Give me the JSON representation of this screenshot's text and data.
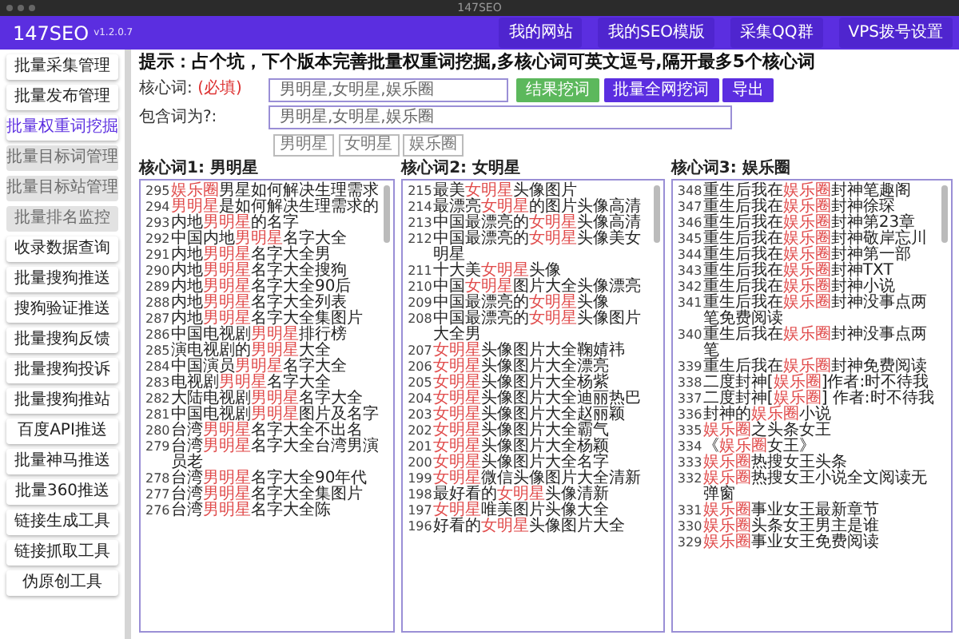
{
  "window": {
    "title": "147SEO"
  },
  "navbar": {
    "brand": "147SEO",
    "version": "v1.2.0.7",
    "links": [
      "我的网站",
      "我的SEO模版",
      "采集QQ群",
      "VPS拨号设置"
    ]
  },
  "sidebar": {
    "items": [
      {
        "label": "批量采集管理",
        "selected": false,
        "disabled": false
      },
      {
        "label": "批量发布管理",
        "selected": false,
        "disabled": false
      },
      {
        "label": "批量权重词挖掘",
        "selected": true,
        "disabled": false
      },
      {
        "label": "批量目标词管理",
        "selected": false,
        "disabled": true
      },
      {
        "label": "批量目标站管理",
        "selected": false,
        "disabled": true
      },
      {
        "label": "批量排名监控",
        "selected": false,
        "disabled": true
      },
      {
        "label": "收录数据查询",
        "selected": false,
        "disabled": false
      },
      {
        "label": "批量搜狗推送",
        "selected": false,
        "disabled": false
      },
      {
        "label": "搜狗验证推送",
        "selected": false,
        "disabled": false
      },
      {
        "label": "批量搜狗反馈",
        "selected": false,
        "disabled": false
      },
      {
        "label": "批量搜狗投诉",
        "selected": false,
        "disabled": false
      },
      {
        "label": "批量搜狗推站",
        "selected": false,
        "disabled": false
      },
      {
        "label": "百度API推送",
        "selected": false,
        "disabled": false
      },
      {
        "label": "批量神马推送",
        "selected": false,
        "disabled": false
      },
      {
        "label": "批量360推送",
        "selected": false,
        "disabled": false
      },
      {
        "label": "链接生成工具",
        "selected": false,
        "disabled": false
      },
      {
        "label": "链接抓取工具",
        "selected": false,
        "disabled": false
      },
      {
        "label": "伪原创工具",
        "selected": false,
        "disabled": false
      }
    ]
  },
  "tip": "提示：占个坑，下个版本完善批量权重词挖掘,多核心词可英文逗号,隔开最多5个核心词",
  "core_field": {
    "label": "核心词:",
    "required_note": "(必填)",
    "value": "男明星,女明星,娱乐圈"
  },
  "buttons": [
    {
      "label": "结果挖词",
      "kind": "success"
    },
    {
      "label": "批量全网挖词",
      "kind": "primary"
    },
    {
      "label": "导出",
      "kind": "primary"
    }
  ],
  "include_field": {
    "label": "包含词为?:",
    "value": "男明星,女明星,娱乐圈",
    "tags": [
      "男明星",
      "女明星",
      "娱乐圈"
    ]
  },
  "columns": [
    {
      "title": "核心词1: 男明星",
      "rows": [
        {
          "number": "295",
          "parts": [
            {
              "text": "娱乐圈",
              "highlight": true
            },
            {
              "text": "男星如何解决生理需求",
              "highlight": false
            }
          ]
        },
        {
          "number": "294",
          "parts": [
            {
              "text": "男明星",
              "highlight": true
            },
            {
              "text": "是如何解决生理需求的",
              "highlight": false
            }
          ]
        },
        {
          "number": "293",
          "parts": [
            {
              "text": "内地",
              "highlight": false
            },
            {
              "text": "男明星",
              "highlight": true
            },
            {
              "text": "的名字",
              "highlight": false
            }
          ]
        },
        {
          "number": "292",
          "parts": [
            {
              "text": "中国内地",
              "highlight": false
            },
            {
              "text": "男明星",
              "highlight": true
            },
            {
              "text": "名字大全",
              "highlight": false
            }
          ]
        },
        {
          "number": "291",
          "parts": [
            {
              "text": "内地",
              "highlight": false
            },
            {
              "text": "男明星",
              "highlight": true
            },
            {
              "text": "名字大全男",
              "highlight": false
            }
          ]
        },
        {
          "number": "290",
          "parts": [
            {
              "text": "内地",
              "highlight": false
            },
            {
              "text": "男明星",
              "highlight": true
            },
            {
              "text": "名字大全搜狗",
              "highlight": false
            }
          ]
        },
        {
          "number": "289",
          "parts": [
            {
              "text": "内地",
              "highlight": false
            },
            {
              "text": "男明星",
              "highlight": true
            },
            {
              "text": "名字大全90后",
              "highlight": false
            }
          ]
        },
        {
          "number": "288",
          "parts": [
            {
              "text": "内地",
              "highlight": false
            },
            {
              "text": "男明星",
              "highlight": true
            },
            {
              "text": "名字大全列表",
              "highlight": false
            }
          ]
        },
        {
          "number": "287",
          "parts": [
            {
              "text": "内地",
              "highlight": false
            },
            {
              "text": "男明星",
              "highlight": true
            },
            {
              "text": "名字大全集图片",
              "highlight": false
            }
          ]
        },
        {
          "number": "286",
          "parts": [
            {
              "text": "中国电视剧",
              "highlight": false
            },
            {
              "text": "男明星",
              "highlight": true
            },
            {
              "text": "排行榜",
              "highlight": false
            }
          ]
        },
        {
          "number": "285",
          "parts": [
            {
              "text": "演电视剧的",
              "highlight": false
            },
            {
              "text": "男明星",
              "highlight": true
            },
            {
              "text": "大全",
              "highlight": false
            }
          ]
        },
        {
          "number": "284",
          "parts": [
            {
              "text": "中国演员",
              "highlight": false
            },
            {
              "text": "男明星",
              "highlight": true
            },
            {
              "text": "名字大全",
              "highlight": false
            }
          ]
        },
        {
          "number": "283",
          "parts": [
            {
              "text": "电视剧",
              "highlight": false
            },
            {
              "text": "男明星",
              "highlight": true
            },
            {
              "text": "名字大全",
              "highlight": false
            }
          ]
        },
        {
          "number": "282",
          "parts": [
            {
              "text": "大陆电视剧",
              "highlight": false
            },
            {
              "text": "男明星",
              "highlight": true
            },
            {
              "text": "名字大全",
              "highlight": false
            }
          ]
        },
        {
          "number": "281",
          "parts": [
            {
              "text": "中国电视剧",
              "highlight": false
            },
            {
              "text": "男明星",
              "highlight": true
            },
            {
              "text": "图片及名字",
              "highlight": false
            }
          ]
        },
        {
          "number": "280",
          "parts": [
            {
              "text": "台湾",
              "highlight": false
            },
            {
              "text": "男明星",
              "highlight": true
            },
            {
              "text": "名字大全不出名",
              "highlight": false
            }
          ]
        },
        {
          "number": "279",
          "parts": [
            {
              "text": "台湾",
              "highlight": false
            },
            {
              "text": "男明星",
              "highlight": true
            },
            {
              "text": "名字大全台湾男演员老",
              "highlight": false
            }
          ]
        },
        {
          "number": "278",
          "parts": [
            {
              "text": "台湾",
              "highlight": false
            },
            {
              "text": "男明星",
              "highlight": true
            },
            {
              "text": "名字大全90年代",
              "highlight": false
            }
          ]
        },
        {
          "number": "277",
          "parts": [
            {
              "text": "台湾",
              "highlight": false
            },
            {
              "text": "男明星",
              "highlight": true
            },
            {
              "text": "名字大全集图片",
              "highlight": false
            }
          ]
        },
        {
          "number": "276",
          "parts": [
            {
              "text": "台湾",
              "highlight": false
            },
            {
              "text": "男明星",
              "highlight": true
            },
            {
              "text": "名字大全陈",
              "highlight": false
            }
          ]
        }
      ]
    },
    {
      "title": "核心词2: 女明星",
      "rows": [
        {
          "number": "215",
          "parts": [
            {
              "text": "最美",
              "highlight": false
            },
            {
              "text": "女明星",
              "highlight": true
            },
            {
              "text": "头像图片",
              "highlight": false
            }
          ]
        },
        {
          "number": "214",
          "parts": [
            {
              "text": "最漂亮",
              "highlight": false
            },
            {
              "text": "女明星",
              "highlight": true
            },
            {
              "text": "的图片头像高清",
              "highlight": false
            }
          ]
        },
        {
          "number": "213",
          "parts": [
            {
              "text": "中国最漂亮的",
              "highlight": false
            },
            {
              "text": "女明星",
              "highlight": true
            },
            {
              "text": "头像高清",
              "highlight": false
            }
          ]
        },
        {
          "number": "212",
          "parts": [
            {
              "text": "中国最漂亮的",
              "highlight": false
            },
            {
              "text": "女明星",
              "highlight": true
            },
            {
              "text": "头像美女明星",
              "highlight": false
            }
          ]
        },
        {
          "number": "211",
          "parts": [
            {
              "text": "十大美",
              "highlight": false
            },
            {
              "text": "女明星",
              "highlight": true
            },
            {
              "text": "头像",
              "highlight": false
            }
          ]
        },
        {
          "number": "210",
          "parts": [
            {
              "text": "中国",
              "highlight": false
            },
            {
              "text": "女明星",
              "highlight": true
            },
            {
              "text": "图片大全头像漂亮",
              "highlight": false
            }
          ]
        },
        {
          "number": "209",
          "parts": [
            {
              "text": "中国最漂亮的",
              "highlight": false
            },
            {
              "text": "女明星",
              "highlight": true
            },
            {
              "text": "头像",
              "highlight": false
            }
          ]
        },
        {
          "number": "208",
          "parts": [
            {
              "text": "中国最漂亮的",
              "highlight": false
            },
            {
              "text": "女明星",
              "highlight": true
            },
            {
              "text": "头像图片大全男",
              "highlight": false
            }
          ]
        },
        {
          "number": "207",
          "parts": [
            {
              "text": "女明星",
              "highlight": true
            },
            {
              "text": "头像图片大全鞠婧祎",
              "highlight": false
            }
          ]
        },
        {
          "number": "206",
          "parts": [
            {
              "text": "女明星",
              "highlight": true
            },
            {
              "text": "头像图片大全漂亮",
              "highlight": false
            }
          ]
        },
        {
          "number": "205",
          "parts": [
            {
              "text": "女明星",
              "highlight": true
            },
            {
              "text": "头像图片大全杨紫",
              "highlight": false
            }
          ]
        },
        {
          "number": "204",
          "parts": [
            {
              "text": "女明星",
              "highlight": true
            },
            {
              "text": "头像图片大全迪丽热巴",
              "highlight": false
            }
          ]
        },
        {
          "number": "203",
          "parts": [
            {
              "text": "女明星",
              "highlight": true
            },
            {
              "text": "头像图片大全赵丽颖",
              "highlight": false
            }
          ]
        },
        {
          "number": "202",
          "parts": [
            {
              "text": "女明星",
              "highlight": true
            },
            {
              "text": "头像图片大全霸气",
              "highlight": false
            }
          ]
        },
        {
          "number": "201",
          "parts": [
            {
              "text": "女明星",
              "highlight": true
            },
            {
              "text": "头像图片大全杨颖",
              "highlight": false
            }
          ]
        },
        {
          "number": "200",
          "parts": [
            {
              "text": "女明星",
              "highlight": true
            },
            {
              "text": "头像图片大全名字",
              "highlight": false
            }
          ]
        },
        {
          "number": "199",
          "parts": [
            {
              "text": "女明星",
              "highlight": true
            },
            {
              "text": "微信头像图片大全清新",
              "highlight": false
            }
          ]
        },
        {
          "number": "198",
          "parts": [
            {
              "text": "最好看的",
              "highlight": false
            },
            {
              "text": "女明星",
              "highlight": true
            },
            {
              "text": "头像清新",
              "highlight": false
            }
          ]
        },
        {
          "number": "197",
          "parts": [
            {
              "text": "女明星",
              "highlight": true
            },
            {
              "text": "唯美图片头像大全",
              "highlight": false
            }
          ]
        },
        {
          "number": "196",
          "parts": [
            {
              "text": "好看的",
              "highlight": false
            },
            {
              "text": "女明星",
              "highlight": true
            },
            {
              "text": "头像图片大全",
              "highlight": false
            }
          ]
        }
      ]
    },
    {
      "title": "核心词3: 娱乐圈",
      "rows": [
        {
          "number": "348",
          "parts": [
            {
              "text": "重生后我在",
              "highlight": false
            },
            {
              "text": "娱乐圈",
              "highlight": true
            },
            {
              "text": "封神笔趣阁",
              "highlight": false
            }
          ]
        },
        {
          "number": "347",
          "parts": [
            {
              "text": "重生后我在",
              "highlight": false
            },
            {
              "text": "娱乐圈",
              "highlight": true
            },
            {
              "text": "封神徐琛",
              "highlight": false
            }
          ]
        },
        {
          "number": "346",
          "parts": [
            {
              "text": "重生后我在",
              "highlight": false
            },
            {
              "text": "娱乐圈",
              "highlight": true
            },
            {
              "text": "封神第23章",
              "highlight": false
            }
          ]
        },
        {
          "number": "345",
          "parts": [
            {
              "text": "重生后我在",
              "highlight": false
            },
            {
              "text": "娱乐圈",
              "highlight": true
            },
            {
              "text": "封神敬岸忘川",
              "highlight": false
            }
          ]
        },
        {
          "number": "344",
          "parts": [
            {
              "text": "重生后我在",
              "highlight": false
            },
            {
              "text": "娱乐圈",
              "highlight": true
            },
            {
              "text": "封神第一部",
              "highlight": false
            }
          ]
        },
        {
          "number": "343",
          "parts": [
            {
              "text": "重生后我在",
              "highlight": false
            },
            {
              "text": "娱乐圈",
              "highlight": true
            },
            {
              "text": "封神TXT",
              "highlight": false
            }
          ]
        },
        {
          "number": "342",
          "parts": [
            {
              "text": "重生后我在",
              "highlight": false
            },
            {
              "text": "娱乐圈",
              "highlight": true
            },
            {
              "text": "封神小说",
              "highlight": false
            }
          ]
        },
        {
          "number": "341",
          "parts": [
            {
              "text": "重生后我在",
              "highlight": false
            },
            {
              "text": "娱乐圈",
              "highlight": true
            },
            {
              "text": "封神没事点两笔免费阅读",
              "highlight": false
            }
          ]
        },
        {
          "number": "340",
          "parts": [
            {
              "text": "重生后我在",
              "highlight": false
            },
            {
              "text": "娱乐圈",
              "highlight": true
            },
            {
              "text": "封神没事点两笔",
              "highlight": false
            }
          ]
        },
        {
          "number": "339",
          "parts": [
            {
              "text": "重生后我在",
              "highlight": false
            },
            {
              "text": "娱乐圈",
              "highlight": true
            },
            {
              "text": "封神免费阅读",
              "highlight": false
            }
          ]
        },
        {
          "number": "338",
          "parts": [
            {
              "text": "二度封神[",
              "highlight": false
            },
            {
              "text": "娱乐圈",
              "highlight": true
            },
            {
              "text": "]作者:时不待我",
              "highlight": false
            }
          ]
        },
        {
          "number": "337",
          "parts": [
            {
              "text": "二度封神[",
              "highlight": false
            },
            {
              "text": "娱乐圈",
              "highlight": true
            },
            {
              "text": "] 作者:时不待我",
              "highlight": false
            }
          ]
        },
        {
          "number": "336",
          "parts": [
            {
              "text": "封神的",
              "highlight": false
            },
            {
              "text": "娱乐圈",
              "highlight": true
            },
            {
              "text": "小说",
              "highlight": false
            }
          ]
        },
        {
          "number": "335",
          "parts": [
            {
              "text": "娱乐圈",
              "highlight": true
            },
            {
              "text": "之头条女王",
              "highlight": false
            }
          ]
        },
        {
          "number": "334",
          "parts": [
            {
              "text": "《",
              "highlight": false
            },
            {
              "text": "娱乐圈",
              "highlight": true
            },
            {
              "text": "女王》",
              "highlight": false
            }
          ]
        },
        {
          "number": "333",
          "parts": [
            {
              "text": "娱乐圈",
              "highlight": true
            },
            {
              "text": "热搜女王头条",
              "highlight": false
            }
          ]
        },
        {
          "number": "332",
          "parts": [
            {
              "text": "娱乐圈",
              "highlight": true
            },
            {
              "text": "热搜女王小说全文阅读无弹窗",
              "highlight": false
            }
          ]
        },
        {
          "number": "331",
          "parts": [
            {
              "text": "娱乐圈",
              "highlight": true
            },
            {
              "text": "事业女王最新章节",
              "highlight": false
            }
          ]
        },
        {
          "number": "330",
          "parts": [
            {
              "text": "娱乐圈",
              "highlight": true
            },
            {
              "text": "头条女王男主是谁",
              "highlight": false
            }
          ]
        },
        {
          "number": "329",
          "parts": [
            {
              "text": "娱乐圈",
              "highlight": true
            },
            {
              "text": "事业女王免费阅读",
              "highlight": false
            }
          ]
        }
      ]
    }
  ]
}
